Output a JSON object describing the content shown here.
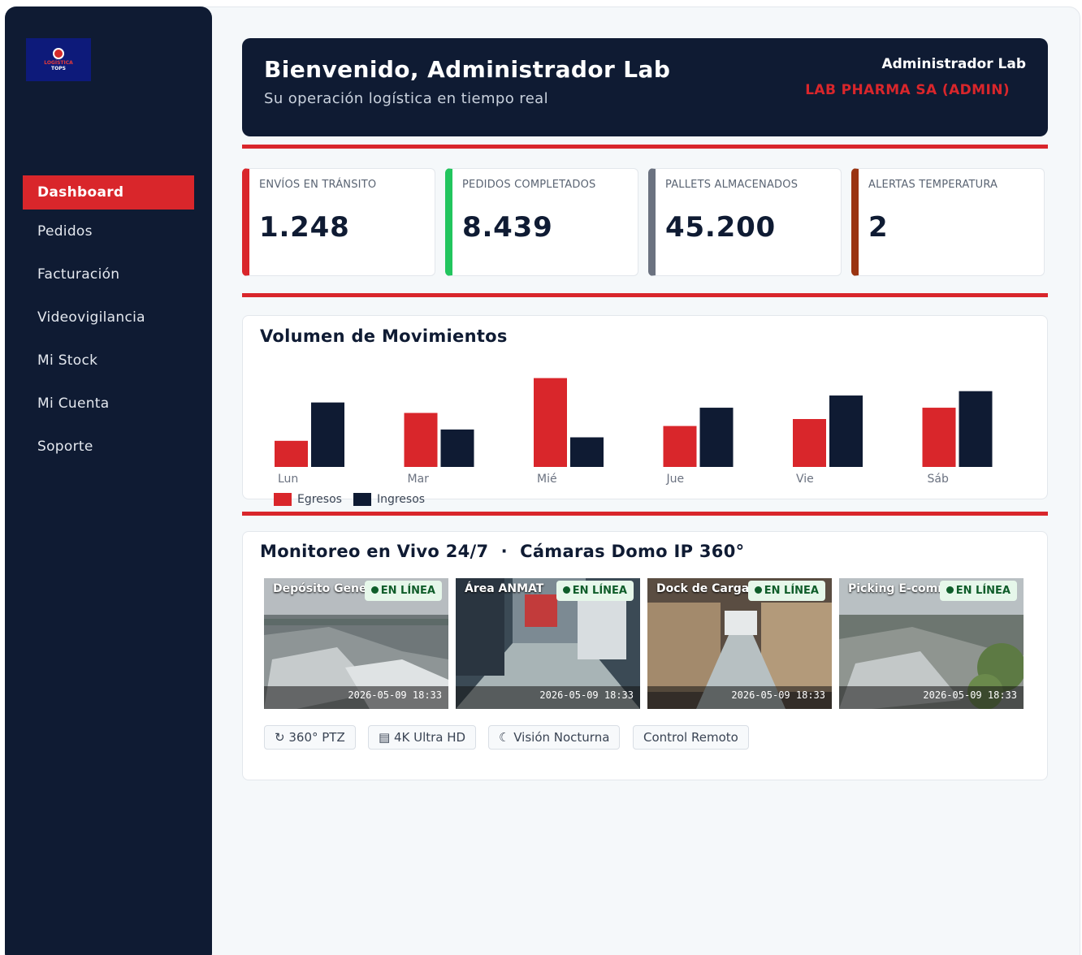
{
  "brand": {
    "logo_line1": "LOGÍSTICA",
    "logo_line2": "TOPS"
  },
  "sidebar": {
    "items": [
      {
        "label": "Dashboard",
        "active": true
      },
      {
        "label": "Pedidos"
      },
      {
        "label": "Facturación"
      },
      {
        "label": "Videovigilancia"
      },
      {
        "label": "Mi Stock"
      },
      {
        "label": "Mi Cuenta"
      },
      {
        "label": "Soporte"
      }
    ]
  },
  "header": {
    "title": "Bienvenido, Administrador Lab",
    "subtitle": "Su operación logística en tiempo real",
    "user_name": "Administrador Lab",
    "organization": "LAB PHARMA SA (ADMIN)"
  },
  "stats": [
    {
      "label": "ENVÍOS EN TRÁNSITO",
      "value": "1.248",
      "color": "#d9262b"
    },
    {
      "label": "PEDIDOS COMPLETADOS",
      "value": "8.439",
      "color": "#22c55e"
    },
    {
      "label": "PALLETS ALMACENADOS",
      "value": "45.200",
      "color": "#6b7280"
    },
    {
      "label": "ALERTAS TEMPERATURA",
      "value": "2",
      "color": "#9a3412"
    }
  ],
  "movements": {
    "title": "Volumen de Movimientos",
    "chart_data": {
      "type": "bar",
      "categories": [
        "Lun",
        "Mar",
        "Mié",
        "Jue",
        "Vie",
        "Sáb"
      ],
      "series": [
        {
          "name": "Egresos",
          "color": "#d9262b",
          "values": [
            30,
            62,
            102,
            47,
            55,
            68
          ]
        },
        {
          "name": "Ingresos",
          "color": "#0f1b33",
          "values": [
            74,
            43,
            34,
            68,
            82,
            87
          ]
        }
      ],
      "ylim": [
        0,
        110
      ],
      "grid": false,
      "legend": "bottom-left"
    }
  },
  "monitor": {
    "title": "Monitoreo en Vivo 24/7  ·  Cámaras Domo IP 360°",
    "cameras": [
      {
        "name": "Depósito General",
        "status": "EN LÍNEA",
        "timestamp": "2026-05-09 18:33",
        "scene": "rooftops"
      },
      {
        "name": "Área ANMAT",
        "status": "EN LÍNEA",
        "timestamp": "2026-05-09 18:33",
        "scene": "warehouse-aisle"
      },
      {
        "name": "Dock de Carga",
        "status": "EN LÍNEA",
        "timestamp": "2026-05-09 18:33",
        "scene": "warehouse-shelves"
      },
      {
        "name": "Picking E-commerce",
        "status": "EN LÍNEA",
        "timestamp": "2026-05-09 18:33",
        "scene": "rooftops-trees"
      }
    ],
    "features": [
      {
        "icon": "↻",
        "label": "360° PTZ"
      },
      {
        "icon": "▤",
        "label": "4K Ultra HD"
      },
      {
        "icon": "☾",
        "label": "Visión Nocturna"
      },
      {
        "icon": "",
        "label": "Control Remoto"
      }
    ]
  }
}
